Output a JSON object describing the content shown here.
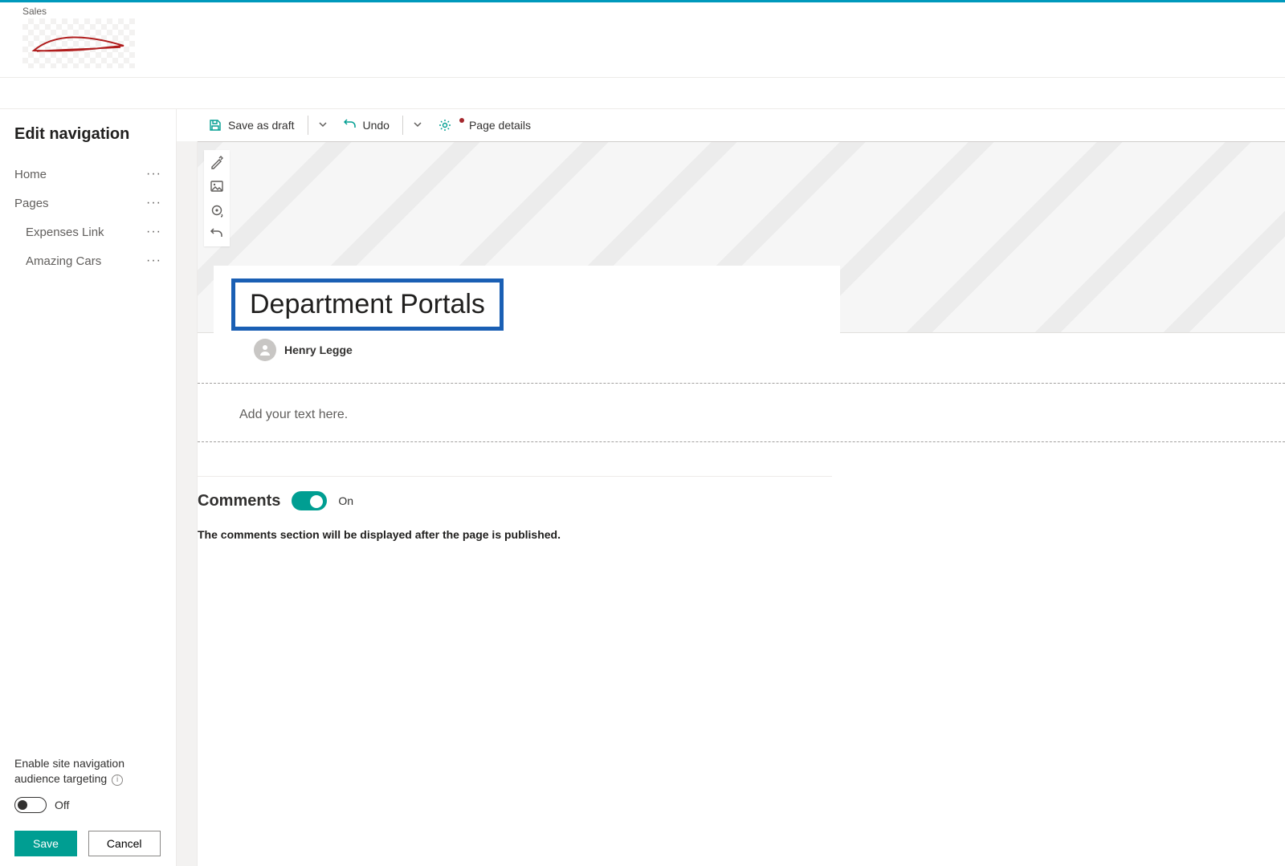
{
  "site": {
    "label": "Sales"
  },
  "sidebar": {
    "title": "Edit navigation",
    "items": [
      {
        "label": "Home",
        "indent": false
      },
      {
        "label": "Pages",
        "indent": false
      },
      {
        "label": "Expenses Link",
        "indent": true
      },
      {
        "label": "Amazing Cars",
        "indent": true
      }
    ],
    "audience_targeting_label": "Enable site navigation audience targeting",
    "audience_toggle_state": "Off",
    "save_label": "Save",
    "cancel_label": "Cancel"
  },
  "commandbar": {
    "save_draft": "Save as draft",
    "undo": "Undo",
    "page_details": "Page details"
  },
  "page": {
    "title": "Department Portals",
    "author": "Henry Legge",
    "text_placeholder": "Add your text here."
  },
  "comments": {
    "heading": "Comments",
    "toggle_state": "On",
    "note": "The comments section will be displayed after the page is published."
  },
  "icons": {
    "more": "···"
  }
}
